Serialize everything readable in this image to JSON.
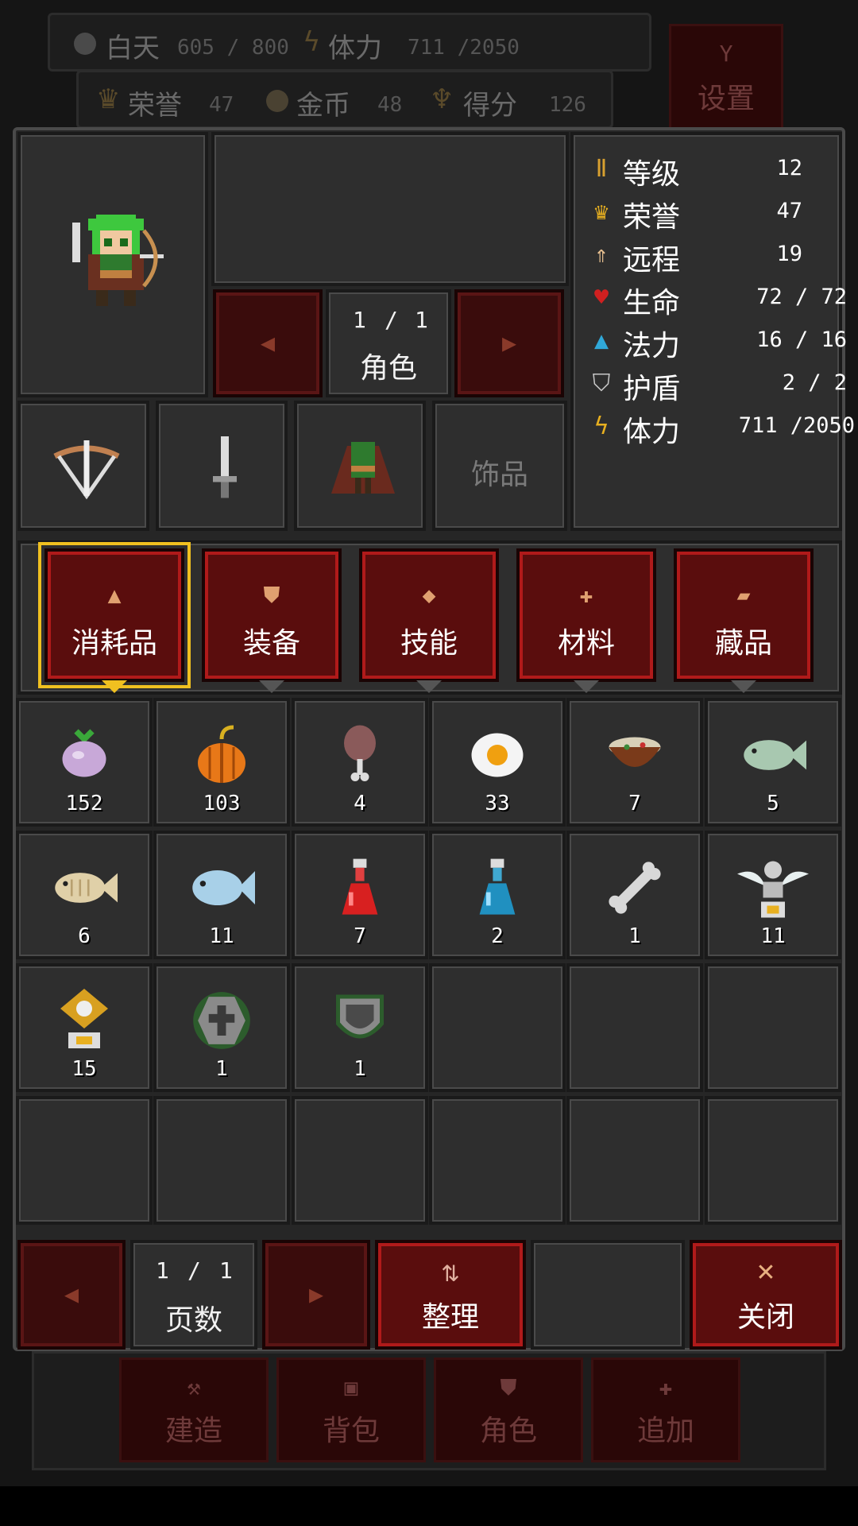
{
  "hud": {
    "day_label": "白天",
    "day_value": "605 / 800",
    "stamina_label": "体力",
    "stamina_value": "711 /2050",
    "honor_label": "荣誉",
    "honor_value": "47",
    "gold_label": "金币",
    "gold_value": "48",
    "score_label": "得分",
    "score_value": "126",
    "settings_label": "设置"
  },
  "character": {
    "page": {
      "current": "1",
      "sep": "/",
      "total": "1"
    },
    "page_label": "角色",
    "accessory_label": "饰品"
  },
  "stats": [
    {
      "icon": "rank-icon",
      "name": "等级",
      "value": "12"
    },
    {
      "icon": "crown-icon",
      "name": "荣誉",
      "value": "47"
    },
    {
      "icon": "ranged-icon",
      "name": "远程",
      "value": "19"
    },
    {
      "icon": "heart-icon",
      "name": "生命",
      "value": "72 / 72"
    },
    {
      "icon": "potion-icon",
      "name": "法力",
      "value": "16 / 16"
    },
    {
      "icon": "shield-icon",
      "name": "护盾",
      "value": "2 / 2"
    },
    {
      "icon": "lightning-icon",
      "name": "体力",
      "value": "711 /2050"
    }
  ],
  "tabs": [
    {
      "label": "消耗品",
      "active": true
    },
    {
      "label": "装备",
      "active": false
    },
    {
      "label": "技能",
      "active": false
    },
    {
      "label": "材料",
      "active": false
    },
    {
      "label": "藏品",
      "active": false
    }
  ],
  "items": [
    {
      "icon": "turnip-icon",
      "count": "152"
    },
    {
      "icon": "pumpkin-icon",
      "count": "103"
    },
    {
      "icon": "drumstick-icon",
      "count": "4"
    },
    {
      "icon": "egg-icon",
      "count": "33"
    },
    {
      "icon": "soup-bowl-icon",
      "count": "7"
    },
    {
      "icon": "fish-icon",
      "count": "5"
    },
    {
      "icon": "dried-fish-icon",
      "count": "6"
    },
    {
      "icon": "blue-fish-icon",
      "count": "11"
    },
    {
      "icon": "red-potion-icon",
      "count": "7"
    },
    {
      "icon": "blue-potion-icon",
      "count": "2"
    },
    {
      "icon": "bone-icon",
      "count": "1"
    },
    {
      "icon": "winged-trophy-icon",
      "count": "11"
    },
    {
      "icon": "gold-ornament-icon",
      "count": "15"
    },
    {
      "icon": "cross-stone-icon",
      "count": "1"
    },
    {
      "icon": "shield-item-icon",
      "count": "1"
    }
  ],
  "footer": {
    "page": {
      "current": "1",
      "sep": "/",
      "total": "1"
    },
    "page_label": "页数",
    "sort_label": "整理",
    "close_label": "关闭"
  },
  "bottom_nav": [
    {
      "label": "建造"
    },
    {
      "label": "背包"
    },
    {
      "label": "角色"
    },
    {
      "label": "追加"
    }
  ],
  "colors": {
    "accent_gold": "#f0c020",
    "button_red": "#5a0d0d",
    "panel_bg": "#262626"
  }
}
